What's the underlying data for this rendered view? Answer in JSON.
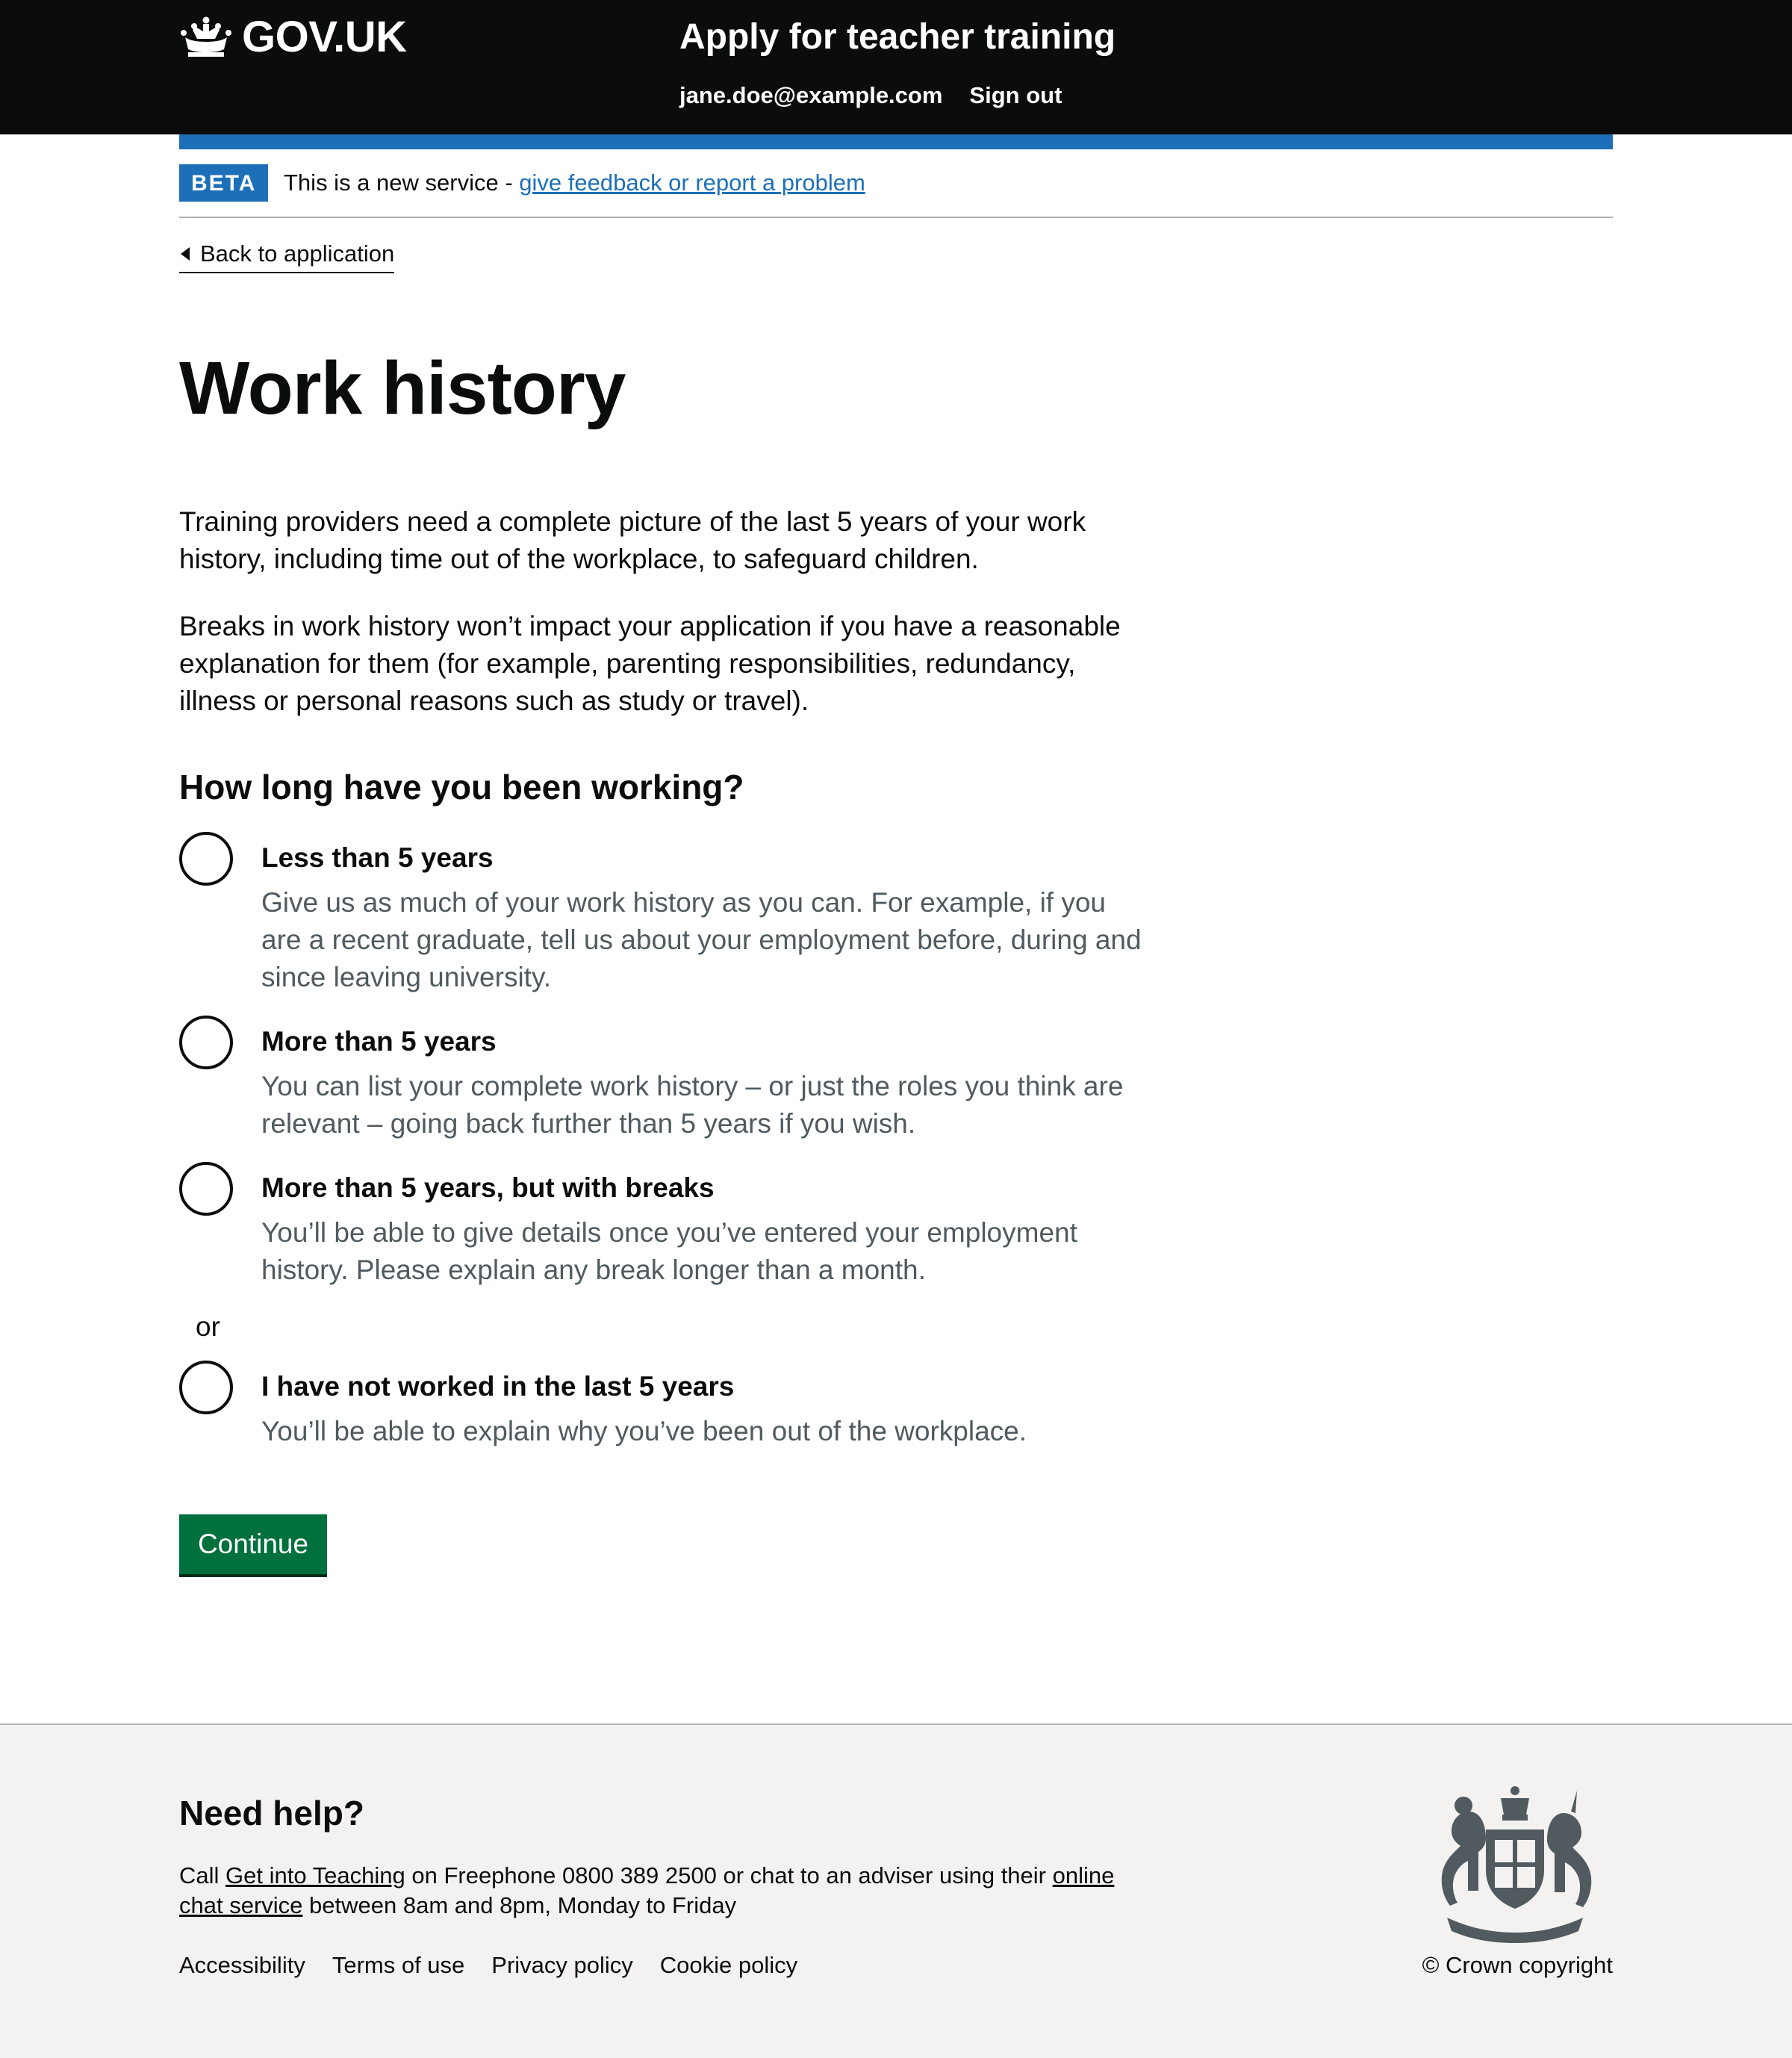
{
  "header": {
    "logo_text": "GOV.UK",
    "service_name": "Apply for teacher training",
    "user_email": "jane.doe@example.com",
    "sign_out": "Sign out"
  },
  "phase_banner": {
    "tag": "BETA",
    "text": "This is a new service - ",
    "link": "give feedback or report a problem"
  },
  "back_link": "Back to application",
  "page": {
    "title": "Work history",
    "intro_1": "Training providers need a complete picture of the last 5 years of your work history, including time out of the workplace, to safeguard children.",
    "intro_2": "Breaks in work history won’t impact your application if you have a reasonable explanation for them (for example, parenting responsibilities, redundancy, illness or personal reasons such as study or travel).",
    "question": "How long have you been working?",
    "options": [
      {
        "label": "Less than 5 years",
        "hint": "Give us as much of your work history as you can. For example, if you are a recent graduate, tell us about your employment before, during and since leaving university.",
        "selected": false
      },
      {
        "label": "More than 5 years",
        "hint": "You can list your complete work history – or just the roles you think are relevant – going back further than 5 years if you wish.",
        "selected": false
      },
      {
        "label": "More than 5 years, but with breaks",
        "hint": "You’ll be able to give details once you’ve entered your employment history. Please explain any break longer than a month.",
        "selected": false
      },
      {
        "label": "I have not worked in the last 5 years",
        "hint": "You’ll be able to explain why you’ve been out of the workplace.",
        "selected": false
      }
    ],
    "divider": "or",
    "continue": "Continue"
  },
  "footer": {
    "help_title": "Need help?",
    "help_call": "Call ",
    "help_link_1": "Get into Teaching",
    "help_mid": " on Freephone 0800 389 2500 or chat to an adviser using their ",
    "help_link_2": "online chat service",
    "help_end": " between 8am and 8pm, Monday to Friday",
    "links": [
      "Accessibility",
      "Terms of use",
      "Privacy policy",
      "Cookie policy"
    ],
    "copyright": "© Crown copyright"
  },
  "colors": {
    "header_bg": "#0b0c0c",
    "brand_blue": "#1d70b8",
    "button_green": "#00703c",
    "hint_grey": "#505a5f",
    "footer_bg": "#f3f2f1"
  }
}
